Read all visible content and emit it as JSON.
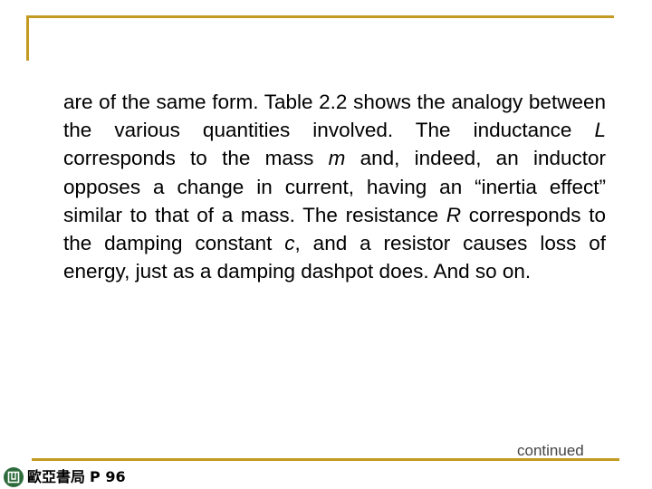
{
  "slide": {
    "accent_color": "#C39B22",
    "body_segments": [
      {
        "text": "are of the same form. Table 2.2 shows the analogy between the various quantities involved. The inductance ",
        "italic": false
      },
      {
        "text": "L",
        "italic": true
      },
      {
        "text": " corresponds to the mass ",
        "italic": false
      },
      {
        "text": "m",
        "italic": true
      },
      {
        "text": " and, indeed, an inductor opposes a change in current, having an “inertia effect” similar to that of a mass. The resistance ",
        "italic": false
      },
      {
        "text": "R",
        "italic": true
      },
      {
        "text": " corresponds to the damping constant ",
        "italic": false
      },
      {
        "text": "c",
        "italic": true
      },
      {
        "text": ", and a resistor causes loss of energy, just as a damping dashpot does. And so on.",
        "italic": false
      }
    ],
    "continued_label": "continued"
  },
  "footer": {
    "logo_icon": "publisher-logo-icon",
    "publisher": "歐亞書局",
    "page_label": "P 96"
  }
}
